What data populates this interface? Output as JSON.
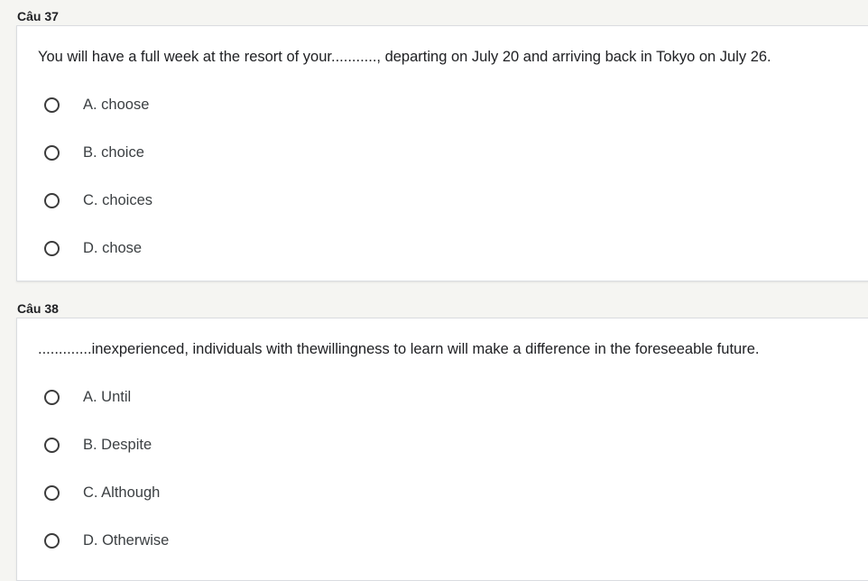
{
  "questions": [
    {
      "label": "Câu 37",
      "text": "You will have a full week at the resort of your..........., departing on July 20 and arriving back in Tokyo on July 26.",
      "options": [
        "A. choose",
        "B. choice",
        "C. choices",
        "D. chose"
      ]
    },
    {
      "label": "Câu 38",
      "text": ".............inexperienced, individuals with thewillingness to learn will make a difference in the foreseeable future.",
      "options": [
        "A. Until",
        "B. Despite",
        "C. Although",
        "D. Otherwise"
      ]
    }
  ]
}
